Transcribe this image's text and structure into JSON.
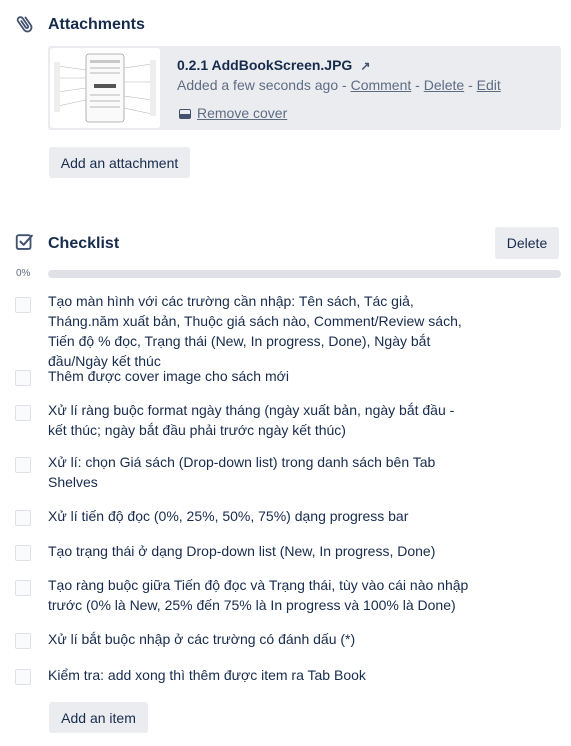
{
  "attachments": {
    "title": "Attachments",
    "items": [
      {
        "name": "0.2.1 AddBookScreen.JPG",
        "added_text": "Added a few seconds ago",
        "sep1": " - ",
        "comment_label": "Comment",
        "sep2": " - ",
        "delete_label": "Delete",
        "sep3": " - ",
        "edit_label": "Edit",
        "remove_cover_label": "Remove cover"
      }
    ],
    "add_button": "Add an attachment"
  },
  "checklist": {
    "title": "Checklist",
    "delete_button": "Delete",
    "progress_label": "0%",
    "progress": 0,
    "items": [
      {
        "text": "Tạo màn hình với các trường cần nhập: Tên sách, Tác giả, Tháng.năm xuất bản, Thuộc giá sách nào, Comment/Review sách, Tiến độ % đọc, Trạng thái (New, In progress, Done), Ngày bắt đầu/Ngày kết thúc",
        "checked": false
      },
      {
        "text": "Thêm được cover image cho sách mới",
        "checked": false
      },
      {
        "text": "Xử lí ràng buộc format ngày tháng (ngày xuất bản, ngày bắt đầu - kết thúc; ngày bắt đầu phải trước ngày kết thúc)",
        "checked": false
      },
      {
        "text": "Xử lí: chọn Giá sách (Drop-down list) trong danh sách bên Tab Shelves",
        "checked": false
      },
      {
        "text": "Xử lí tiến độ đọc (0%, 25%, 50%, 75%) dạng progress bar",
        "checked": false
      },
      {
        "text": "Tạo trạng thái ở dạng Drop-down list (New, In progress, Done)",
        "checked": false
      },
      {
        "text": "Tạo ràng buộc giữa Tiến độ đọc và Trạng thái, tùy vào cái nào nhập trước (0% là New, 25% đến 75% là In progress và 100% là Done)",
        "checked": false
      },
      {
        "text": "Xử lí bắt buộc nhập ở các trường có đánh dấu (*)",
        "checked": false
      },
      {
        "text": "Kiểm tra: add xong thì thêm được item ra Tab Book",
        "checked": false
      }
    ],
    "add_item_button": "Add an item"
  },
  "icons": {
    "attachments": "paperclip-icon",
    "checklist": "checkbox-icon",
    "open_external": "external-link-icon",
    "remove_cover": "card-cover-icon"
  },
  "colors": {
    "text": "#172b4d",
    "muted": "#5e6c84",
    "button_bg": "#ebecf0",
    "progress_track": "#dfe1e6",
    "progress_fill": "#5aac44"
  }
}
